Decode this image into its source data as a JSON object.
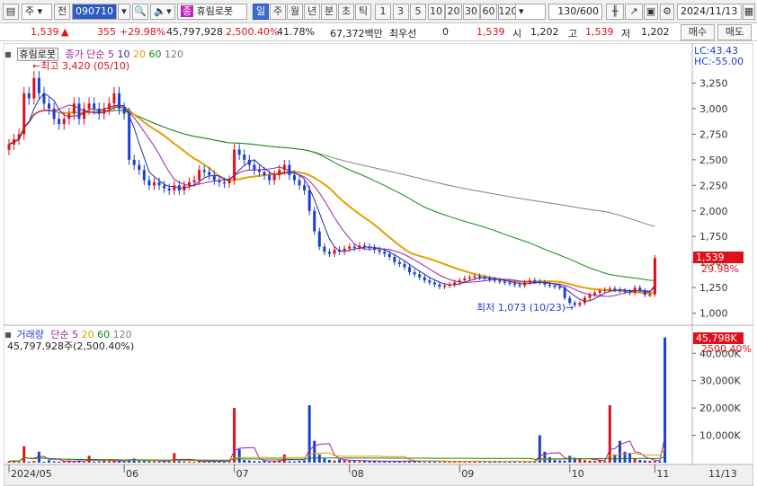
{
  "toolbar": {
    "market": "주",
    "prev_label": "전",
    "code": "090710",
    "name": "휴림로봇",
    "name_badge": "종",
    "periods": [
      "일",
      "주",
      "월",
      "년",
      "분",
      "초",
      "틱"
    ],
    "active_period": "일",
    "intervals": [
      "1",
      "3",
      "5",
      "10",
      "20",
      "30",
      "60",
      "120"
    ],
    "count": "130/600",
    "date": "2024/11/13"
  },
  "quote": {
    "price": "1,539",
    "change": "355",
    "change_pct": "+29.98%",
    "volume": "45,797,928",
    "volume_ratio": "2,500.40%",
    "turnover": "41.78%",
    "amount": "67,372백만",
    "pref_label": "최우선",
    "pref_value": "0",
    "pref_price": "1,539",
    "open_label": "시",
    "open": "1,202",
    "high_label": "고",
    "high": "1,539",
    "low_label": "저",
    "low": "1,202",
    "buy_label": "매수",
    "sell_label": "매도"
  },
  "price_pane": {
    "stock_label": "휴림로봇",
    "ma_label": "종가 단순",
    "ma_periods": [
      "5",
      "10",
      "20",
      "60",
      "120"
    ],
    "lc": "LC:43.43",
    "hc": "HC:-55.00",
    "max_label": "최고 3,420 (05/10)",
    "min_label": "최저 1,073 (10/23)",
    "price_tag": "1,539",
    "pct_tag": "29.98%"
  },
  "volume_pane": {
    "title": "거래량",
    "ma_label": "단순",
    "ma_periods": [
      "5",
      "20",
      "60",
      "120"
    ],
    "value_line": "45,797,928주(2,500.40%)",
    "vol_tag": "45,798K",
    "pct_tag": "2500.40%"
  },
  "chart_data": [
    {
      "type": "candlestick",
      "title": "휴림로봇",
      "y_axis_ticks": [
        "3,250",
        "3,000",
        "2,750",
        "2,500",
        "2,250",
        "2,000",
        "1,750",
        "1,500",
        "1,250",
        "1,000"
      ],
      "ylim": [
        900,
        3500
      ],
      "close": [
        2650,
        2700,
        2750,
        3150,
        3100,
        3300,
        3150,
        3050,
        3000,
        2900,
        2850,
        2900,
        2950,
        3050,
        2900,
        3000,
        3050,
        3000,
        2950,
        3000,
        3050,
        3150,
        3000,
        2950,
        2500,
        2450,
        2400,
        2300,
        2250,
        2280,
        2250,
        2220,
        2200,
        2250,
        2200,
        2250,
        2280,
        2300,
        2400,
        2380,
        2350,
        2300,
        2280,
        2270,
        2300,
        2600,
        2550,
        2500,
        2450,
        2400,
        2380,
        2350,
        2300,
        2350,
        2400,
        2450,
        2350,
        2300,
        2250,
        2200,
        2000,
        1800,
        1650,
        1600,
        1580,
        1620,
        1600,
        1630,
        1650,
        1640,
        1660,
        1650,
        1640,
        1620,
        1600,
        1580,
        1550,
        1500,
        1480,
        1450,
        1400,
        1380,
        1350,
        1320,
        1300,
        1280,
        1260,
        1270,
        1280,
        1300,
        1320,
        1340,
        1350,
        1360,
        1350,
        1340,
        1330,
        1320,
        1310,
        1300,
        1290,
        1280,
        1270,
        1300,
        1320,
        1310,
        1300,
        1280,
        1270,
        1260,
        1250,
        1150,
        1100,
        1080,
        1100,
        1150,
        1180,
        1200,
        1220,
        1230,
        1240,
        1230,
        1220,
        1210,
        1200,
        1250,
        1220,
        1180,
        1184,
        1539
      ],
      "volume_k": [
        500,
        800,
        300,
        6000,
        400,
        600,
        4000,
        300,
        900,
        500,
        400,
        600,
        700,
        500,
        800,
        300,
        2500,
        400,
        500,
        700,
        600,
        800,
        500,
        400,
        1200,
        1500,
        800,
        700,
        600,
        500,
        400,
        500,
        900,
        3500,
        600,
        500,
        400,
        300,
        700,
        500,
        600,
        400,
        500,
        300,
        600,
        20000,
        5000,
        1000,
        800,
        600,
        500,
        700,
        400,
        600,
        900,
        3000,
        500,
        400,
        600,
        800,
        21000,
        8000,
        3000,
        1500,
        1000,
        800,
        1200,
        900,
        700,
        600,
        500,
        800,
        600,
        500,
        400,
        500,
        600,
        700,
        500,
        400,
        600,
        800,
        500,
        400,
        700,
        600,
        500,
        400,
        300,
        600,
        500,
        400,
        500,
        600,
        500,
        400,
        300,
        700,
        400,
        500,
        600,
        400,
        500,
        300,
        500,
        600,
        10000,
        4000,
        2000,
        1000,
        800,
        700,
        2500,
        1800,
        1500,
        900,
        700,
        600,
        800,
        500,
        21000,
        3000,
        8000,
        4000,
        3500,
        1500,
        1000,
        800,
        700,
        600,
        500,
        45798
      ],
      "x_axis_labels": [
        "2024/05",
        "06",
        "07",
        "08",
        "09",
        "10",
        "11",
        "11/13"
      ],
      "volume_ticks": [
        "40,000K",
        "30,000K",
        "20,000K",
        "10,000K"
      ]
    }
  ],
  "colors": {
    "ma5": "#2a2aa8",
    "ma10": "#a020a0",
    "ma20": "#e3a000",
    "ma60": "#138a13",
    "ma120": "#808080",
    "up": "#e0101a",
    "down": "#1b3fd6"
  }
}
